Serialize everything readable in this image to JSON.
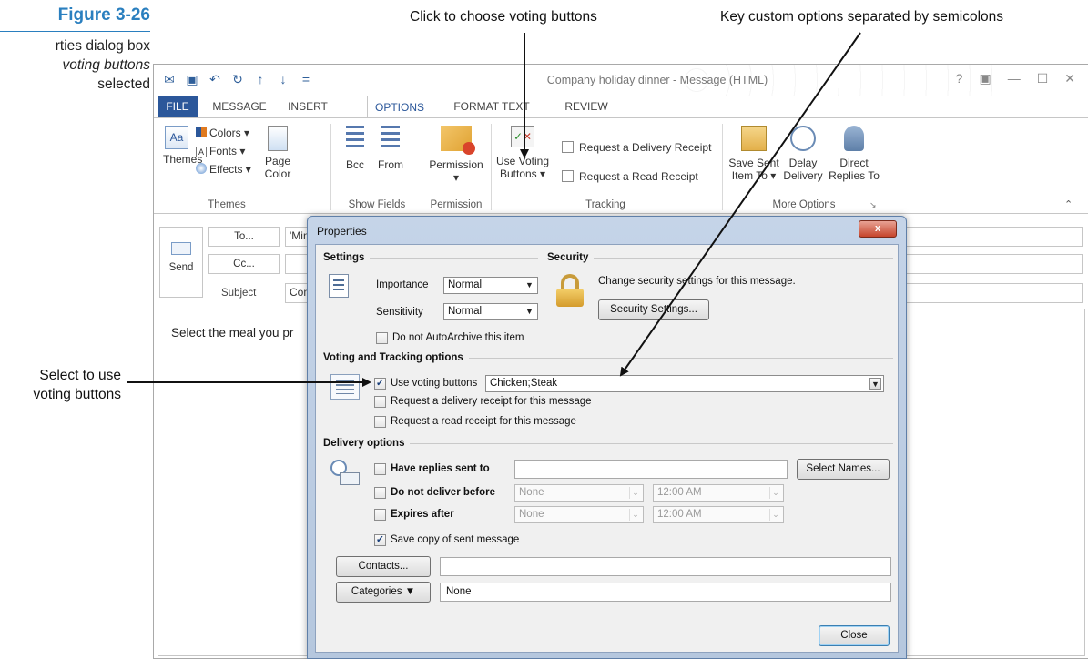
{
  "figure": {
    "number": "Figure 3-26",
    "caption_line1": "rties dialog box",
    "caption_line2_italic": "voting buttons",
    "caption_line3": "selected"
  },
  "callouts": {
    "voting_buttons_top": "Click to choose voting buttons",
    "custom_options": "Key custom options separated by semicolons",
    "select_line1": "Select to use",
    "select_line2": "voting buttons"
  },
  "window": {
    "title": "Company holiday dinner - Message (HTML)",
    "controls": [
      "?",
      "▣",
      "—",
      "☐",
      "✕"
    ]
  },
  "tabs": [
    "FILE",
    "MESSAGE",
    "INSERT",
    "OPTIONS",
    "FORMAT TEXT",
    "REVIEW"
  ],
  "ribbon": {
    "themes": {
      "themes_label": "Themes",
      "colors": "Colors",
      "fonts": "Fonts",
      "effects": "Effects",
      "page_color_line1": "Page",
      "page_color_line2": "Color",
      "group": "Themes"
    },
    "show_fields": {
      "bcc": "Bcc",
      "from": "From",
      "group": "Show Fields"
    },
    "permission": {
      "label": "Permission",
      "group": "Permission"
    },
    "tracking": {
      "voting_line1": "Use Voting",
      "voting_line2": "Buttons",
      "delivery_receipt": "Request a Delivery Receipt",
      "read_receipt": "Request a Read Receipt",
      "group": "Tracking"
    },
    "more_options": {
      "save_sent_line1": "Save Sent",
      "save_sent_line2": "Item To",
      "delay_line1": "Delay",
      "delay_line2": "Delivery",
      "direct_line1": "Direct",
      "direct_line2": "Replies To",
      "group": "More Options"
    }
  },
  "compose": {
    "to_button": "To...",
    "cc_button": "Cc...",
    "send_label": "Send",
    "subject_label": "Subject",
    "to_value": "'Mind",
    "subject_value": "Com",
    "body_text": "Select the meal you pr"
  },
  "dialog": {
    "title": "Properties",
    "close_x": "x",
    "settings": {
      "heading": "Settings",
      "importance_label": "Importance",
      "importance_value": "Normal",
      "sensitivity_label": "Sensitivity",
      "sensitivity_value": "Normal",
      "autoarchive": "Do not AutoArchive this item"
    },
    "security": {
      "heading": "Security",
      "text": "Change security settings for this message.",
      "button": "Security Settings..."
    },
    "voting": {
      "heading": "Voting and Tracking options",
      "use_voting": "Use voting buttons",
      "voting_value": "Chicken;Steak",
      "delivery_receipt": "Request a delivery receipt for this message",
      "read_receipt": "Request a read receipt for this message"
    },
    "delivery": {
      "heading": "Delivery options",
      "have_replies": "Have replies sent to",
      "select_names": "Select Names...",
      "do_not_deliver": "Do not deliver before",
      "expires_after": "Expires after",
      "date_value": "None",
      "time_value": "12:00 AM",
      "save_copy": "Save copy of sent message"
    },
    "contacts_button": "Contacts...",
    "categories_button": "Categories",
    "categories_value": "None",
    "close_button": "Close"
  },
  "colors": {
    "accent": "#2b579a",
    "figure_blue": "#2a7fbf"
  }
}
